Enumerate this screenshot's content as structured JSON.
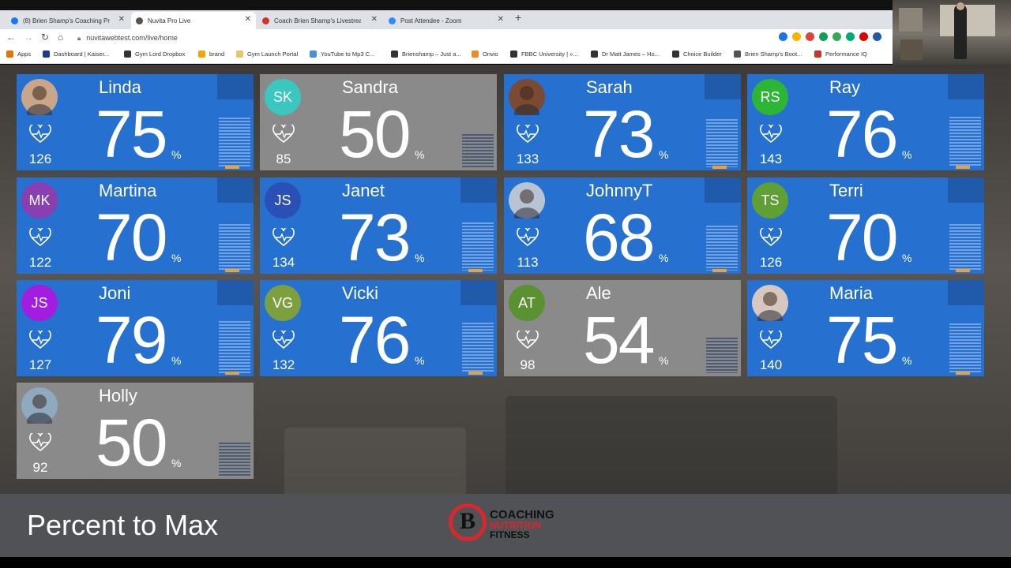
{
  "browser": {
    "tabs": [
      {
        "label": "(8) Brien Shamp's Coaching Prog...",
        "icon": "facebook-icon",
        "color": "#1877f2"
      },
      {
        "label": "Nuvita Pro Live",
        "icon": "globe-icon",
        "color": "#555555"
      },
      {
        "label": "Coach Brien Shamp's Livestream...",
        "icon": "streamyard-icon",
        "color": "#d0342c"
      },
      {
        "label": "Post Attendee - Zoom",
        "icon": "zoom-icon",
        "color": "#2d8cff"
      }
    ],
    "url": "nuvitawebtest.com/live/home",
    "bookmarks": [
      {
        "label": "Apps",
        "icon": "apps-icon"
      },
      {
        "label": "Dashboard | Kaiser...",
        "icon": "kaiser-icon"
      },
      {
        "label": "Gym Lord Dropbox",
        "icon": "dropbox-icon"
      },
      {
        "label": "brand",
        "icon": "folder-icon"
      },
      {
        "label": "Gym Launch Portal",
        "icon": "launch-icon"
      },
      {
        "label": "YouTube to Mp3 C...",
        "icon": "youtube-icon"
      },
      {
        "label": "Brienshamp – Just a...",
        "icon": "globe-icon"
      },
      {
        "label": "Onvio",
        "icon": "onvio-icon"
      },
      {
        "label": "FBBC University | »...",
        "icon": "globe-icon"
      },
      {
        "label": "Dr Matt James – Ho...",
        "icon": "globe-icon"
      },
      {
        "label": "Choice Builder",
        "icon": "globe-icon"
      },
      {
        "label": "Brien Shamp's Boot...",
        "icon": "bookmark-icon"
      },
      {
        "label": "Performance IQ",
        "icon": "piq-icon"
      }
    ]
  },
  "participants": [
    {
      "name": "Linda",
      "percent": "75",
      "hr": "126",
      "initials": "",
      "avatar_color": "#c9a68a",
      "state": "blue",
      "photo": true
    },
    {
      "name": "Sandra",
      "percent": "50",
      "hr": "85",
      "initials": "SK",
      "avatar_color": "#3cc6c0",
      "state": "gray",
      "photo": false
    },
    {
      "name": "Sarah",
      "percent": "73",
      "hr": "133",
      "initials": "",
      "avatar_color": "#7a4a32",
      "state": "blue",
      "photo": true
    },
    {
      "name": "Ray",
      "percent": "76",
      "hr": "143",
      "initials": "RS",
      "avatar_color": "#2db536",
      "state": "blue",
      "photo": false
    },
    {
      "name": "Martina",
      "percent": "70",
      "hr": "122",
      "initials": "MK",
      "avatar_color": "#8a3fb0",
      "state": "blue",
      "photo": false
    },
    {
      "name": "Janet",
      "percent": "73",
      "hr": "134",
      "initials": "JS",
      "avatar_color": "#2a4fb5",
      "state": "blue",
      "photo": false
    },
    {
      "name": "JohnnyT",
      "percent": "68",
      "hr": "113",
      "initials": "",
      "avatar_color": "#b7c4d4",
      "state": "blue",
      "photo": true
    },
    {
      "name": "Terri",
      "percent": "70",
      "hr": "126",
      "initials": "TS",
      "avatar_color": "#5f9f34",
      "state": "blue",
      "photo": false
    },
    {
      "name": "Joni",
      "percent": "79",
      "hr": "127",
      "initials": "JS",
      "avatar_color": "#a31de0",
      "state": "blue",
      "photo": false
    },
    {
      "name": "Vicki",
      "percent": "76",
      "hr": "132",
      "initials": "VG",
      "avatar_color": "#7e9f3e",
      "state": "blue",
      "photo": false
    },
    {
      "name": "Ale",
      "percent": "54",
      "hr": "98",
      "initials": "AT",
      "avatar_color": "#5a9232",
      "state": "gray",
      "photo": false
    },
    {
      "name": "Maria",
      "percent": "75",
      "hr": "140",
      "initials": "",
      "avatar_color": "#d7c7c0",
      "state": "blue",
      "photo": true
    },
    {
      "name": "Holly",
      "percent": "50",
      "hr": "92",
      "initials": "",
      "avatar_color": "#8fa9c0",
      "state": "gray",
      "photo": true
    }
  ],
  "percent_sign": "%",
  "footer": {
    "title": "Percent to Max",
    "logo_letter": "B",
    "logo_line1": "COACHING",
    "logo_line2": "NUTRITION",
    "logo_line3": "FITNESS"
  },
  "colors": {
    "card_active": "#2670d0",
    "card_idle": "#8a8a8a",
    "brand_red": "#d9272e"
  }
}
